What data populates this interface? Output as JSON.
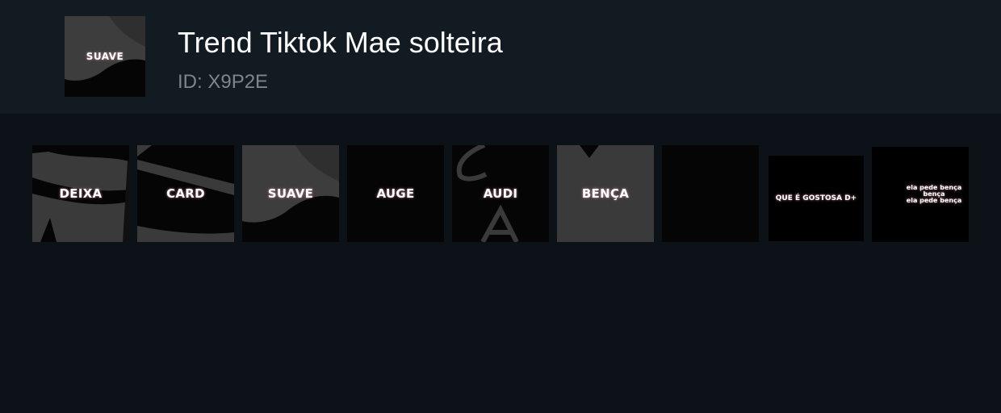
{
  "header": {
    "title": "Trend Tiktok Mae solteira",
    "id_text": "ID: X9P2E",
    "cover": {
      "label": "SUAVE"
    }
  },
  "thumbnails": [
    {
      "label": "DEIXA"
    },
    {
      "label": "CARD"
    },
    {
      "label": "SUAVE"
    },
    {
      "label": "AUGE"
    },
    {
      "label": "AUDI"
    },
    {
      "label": "BENÇA"
    },
    {
      "label": ""
    },
    {
      "label": "QUE É GOSTOSA D+"
    },
    {
      "lines": [
        "ela pede bença",
        "bença",
        "ela pede bença"
      ]
    }
  ],
  "colors": {
    "header_bg": "#121a22",
    "page_bg": "#0d1218",
    "title": "#ffffff",
    "id_text": "#7d858d"
  }
}
